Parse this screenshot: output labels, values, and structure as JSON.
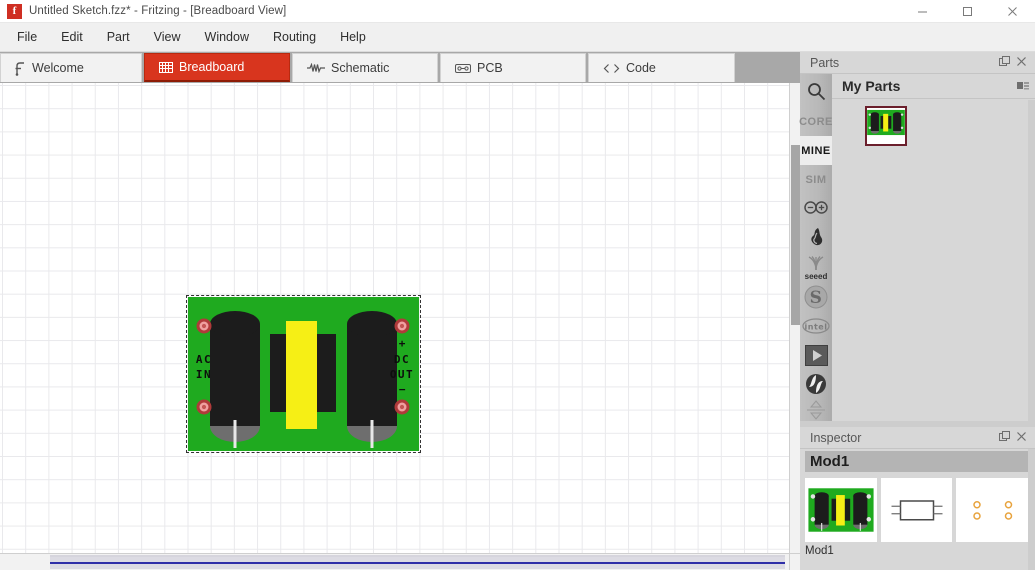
{
  "window": {
    "title": "Untitled Sketch.fzz* - Fritzing - [Breadboard View]",
    "app_icon": "fritzing-logo-icon",
    "controls": [
      {
        "name": "minimize-button",
        "label": "—"
      },
      {
        "name": "maximize-button",
        "label": "□"
      },
      {
        "name": "close-button",
        "label": "✕"
      }
    ]
  },
  "menubar": {
    "items": [
      {
        "label": "File"
      },
      {
        "label": "Edit"
      },
      {
        "label": "Part"
      },
      {
        "label": "View"
      },
      {
        "label": "Window"
      },
      {
        "label": "Routing"
      },
      {
        "label": "Help"
      }
    ]
  },
  "tabs": [
    {
      "label": "Welcome",
      "icon": "fritzing-f-icon",
      "active": false
    },
    {
      "label": "Breadboard",
      "icon": "breadboard-grid-icon",
      "active": true
    },
    {
      "label": "Schematic",
      "icon": "waveform-icon",
      "active": false
    },
    {
      "label": "PCB",
      "icon": "pcb-chip-icon",
      "active": false
    },
    {
      "label": "Code",
      "icon": "angle-brackets-icon",
      "active": false
    }
  ],
  "canvas": {
    "part": {
      "name": "ac-dc-power-supply-module",
      "labels": {
        "ac": "AC",
        "in": "IN",
        "dc": "DC",
        "out": "OUT",
        "plus": "+",
        "minus": "−"
      },
      "colors": {
        "board": "#1faa1f",
        "capacitor": "#1c1c1c",
        "transformer": "#f6ef15",
        "pad_ring": "#b03a3a",
        "pad_center": "#f0a0a0"
      },
      "selected": true
    },
    "scrollbars": {
      "vertical": true,
      "horizontal": true
    }
  },
  "parts_panel": {
    "title": "Parts",
    "header_buttons": [
      {
        "name": "float-panel-button",
        "glyph": "⧉"
      },
      {
        "name": "close-panel-button",
        "glyph": "✕"
      }
    ],
    "bins": [
      {
        "name": "search-bin",
        "label": "",
        "icon": "search-icon",
        "selected": false
      },
      {
        "name": "core-bin",
        "label": "CORE",
        "icon": "text-label",
        "selected": false
      },
      {
        "name": "mine-bin",
        "label": "MINE",
        "icon": "text-label",
        "selected": true
      },
      {
        "name": "sim-bin",
        "label": "SIM",
        "icon": "text-label",
        "selected": false
      },
      {
        "name": "arduino-bin",
        "label": "",
        "icon": "arduino-infinity-icon",
        "selected": false
      },
      {
        "name": "sparkfun-bin",
        "label": "",
        "icon": "sparkfun-flame-icon",
        "selected": false
      },
      {
        "name": "seeed-bin",
        "label": "seeed",
        "icon": "seeed-studio-icon",
        "selected": false
      },
      {
        "name": "snootlab-bin",
        "label": "S",
        "icon": "snootlab-s-icon",
        "selected": false
      },
      {
        "name": "intel-bin",
        "label": "intel",
        "icon": "intel-icon",
        "selected": false
      },
      {
        "name": "play-bin",
        "label": "",
        "icon": "play-triangle-icon",
        "selected": false
      },
      {
        "name": "picaxe-bin",
        "label": "",
        "icon": "picaxe-icon",
        "selected": false
      },
      {
        "name": "bin-scroll",
        "label": "",
        "icon": "scroll-up-down-icon",
        "selected": false
      }
    ],
    "bin_title": "My Parts",
    "bin_menu_icon": "bin-menu-icon",
    "items": [
      {
        "name": "part-mod1",
        "label": "",
        "icon": "ac-dc-module-thumb",
        "selected": true
      }
    ]
  },
  "inspector": {
    "title": "Inspector",
    "header_buttons": [
      {
        "name": "float-panel-button",
        "glyph": "⧉"
      },
      {
        "name": "close-panel-button",
        "glyph": "✕"
      }
    ],
    "part_name": "Mod1",
    "views": [
      {
        "name": "breadboard-view-thumb",
        "icon": "ac-dc-module-thumb"
      },
      {
        "name": "schematic-view-thumb",
        "icon": "schematic-box-icon"
      },
      {
        "name": "pcb-view-thumb",
        "icon": "pcb-pads-icon"
      }
    ],
    "footer_label": "Mod1"
  },
  "theme": {
    "accent_red": "#d8351e",
    "panel_bg": "#d7d7d7",
    "menu_bg": "#f0f0f0",
    "tabbar_bg": "#a8a8a8",
    "grid_line": "#e9e9ec"
  }
}
